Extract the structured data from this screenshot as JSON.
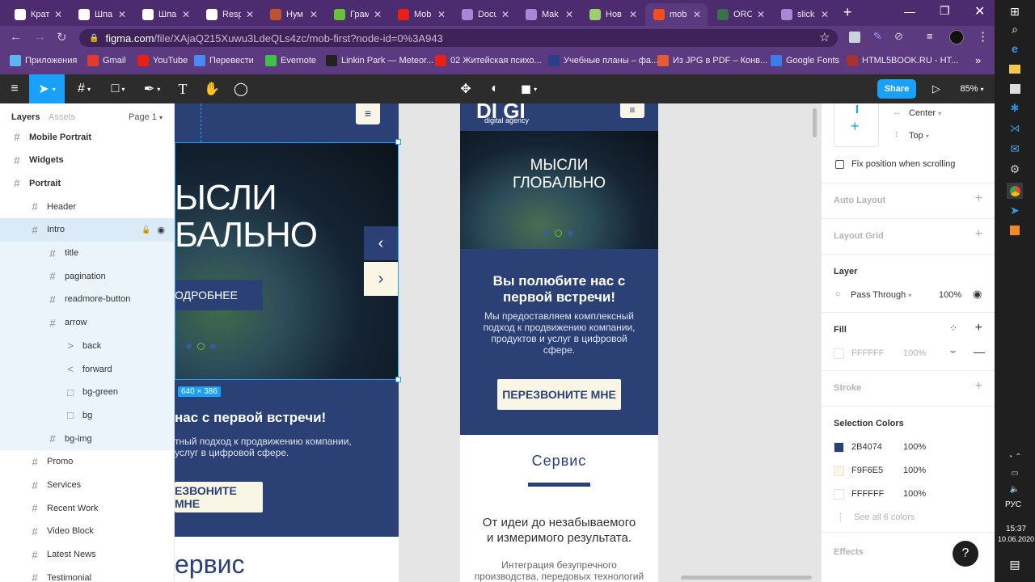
{
  "browser": {
    "tabs": [
      {
        "label": "Крат",
        "color": "#ffffff",
        "active": false
      },
      {
        "label": "Шпа",
        "color": "#ffffff",
        "active": false
      },
      {
        "label": "Шпа",
        "color": "#ffffff",
        "active": false
      },
      {
        "label": "Resp",
        "color": "#ffffff",
        "active": false
      },
      {
        "label": "Нум",
        "color": "#c0522e",
        "active": false
      },
      {
        "label": "Грам",
        "color": "#6cbf3a",
        "active": false
      },
      {
        "label": "Mob",
        "color": "#e62117",
        "active": false
      },
      {
        "label": "Docu",
        "color": "#a987d6",
        "active": false
      },
      {
        "label": "Mak",
        "color": "#a987d6",
        "active": false
      },
      {
        "label": "Нов",
        "color": "#9ccf6e",
        "active": false
      },
      {
        "label": "mob",
        "color": "#f24e1e",
        "active": true
      },
      {
        "label": "ORO",
        "color": "#3c6e4a",
        "active": false
      },
      {
        "label": "slick",
        "color": "#a987d6",
        "active": false
      }
    ],
    "new_tab": "+",
    "url_host": "figma.com",
    "url_path": "/file/XAjaQ215Xuwu3LdeQLs4zc/mob-first?node-id=0%3A943",
    "bookmarks": [
      {
        "label": "Приложения",
        "color": "#5ab5f0"
      },
      {
        "label": "Gmail",
        "color": "#e23a2e"
      },
      {
        "label": "YouTube",
        "color": "#e62117"
      },
      {
        "label": "Перевести",
        "color": "#4a8af4"
      },
      {
        "label": "Evernote",
        "color": "#3ec146"
      },
      {
        "label": "Linkin Park — Meteor...",
        "color": "#222222"
      },
      {
        "label": "02 Житейская психо...",
        "color": "#e62117"
      },
      {
        "label": "Учебные планы – фа...",
        "color": "#2b3e8c"
      },
      {
        "label": "Из JPG в PDF – Конв...",
        "color": "#e25c3a"
      },
      {
        "label": "Google Fonts",
        "color": "#3b7bea"
      },
      {
        "label": "HTML5BOOK.RU - НТ...",
        "color": "#a83232"
      }
    ],
    "bookmarks_more": "»"
  },
  "figma": {
    "share_label": "Share",
    "zoom": "85%",
    "left_tabs": {
      "layers": "Layers",
      "assets": "Assets",
      "page": "Page 1"
    },
    "layers": [
      {
        "label": "Mobile Portrait",
        "indent": 0,
        "bold": true,
        "icon": "#"
      },
      {
        "label": "Widgets",
        "indent": 0,
        "bold": true,
        "icon": "#"
      },
      {
        "label": "Portrait",
        "indent": 0,
        "bold": true,
        "icon": "#"
      },
      {
        "label": "Header",
        "indent": 1,
        "icon": "#"
      },
      {
        "label": "Intro",
        "indent": 1,
        "icon": "#",
        "selected": true
      },
      {
        "label": "title",
        "indent": 2,
        "icon": "#"
      },
      {
        "label": "pagination",
        "indent": 2,
        "icon": "#"
      },
      {
        "label": "readmore-button",
        "indent": 2,
        "icon": "#"
      },
      {
        "label": "arrow",
        "indent": 2,
        "icon": "#"
      },
      {
        "label": "back",
        "indent": 3,
        "icon": ">"
      },
      {
        "label": "forward",
        "indent": 3,
        "icon": "<"
      },
      {
        "label": "bg-green",
        "indent": 3,
        "icon": "□"
      },
      {
        "label": "bg",
        "indent": 3,
        "icon": "□"
      },
      {
        "label": "bg-img",
        "indent": 2,
        "icon": "#"
      },
      {
        "label": "Promo",
        "indent": 1,
        "icon": "#"
      },
      {
        "label": "Services",
        "indent": 1,
        "icon": "#"
      },
      {
        "label": "Recent Work",
        "indent": 1,
        "icon": "#"
      },
      {
        "label": "Video Block",
        "indent": 1,
        "icon": "#"
      },
      {
        "label": "Latest News",
        "indent": 1,
        "icon": "#"
      },
      {
        "label": "Testimonial",
        "indent": 1,
        "icon": "#"
      }
    ],
    "canvas": {
      "frame_a": {
        "hero_line1": "ЫСЛИ",
        "hero_line2": "БАЛЬНО",
        "readmore": "ОДРОБНЕЕ",
        "size_badge": "640 × 386",
        "promo_title": "нас с первой встречи!",
        "promo_text1": "тный подход к продвижению компании,",
        "promo_text2": "услуг в цифровой сфере.",
        "callback": "ЕЗВОНИТЕ МНЕ",
        "service": "ервис"
      },
      "frame_b": {
        "logo": "DI GI",
        "logo_sub": "digital agency",
        "hero1": "МЫСЛИ",
        "hero2": "ГЛОБАЛЬНО",
        "promo_title1": "Вы полюбите нас с",
        "promo_title2": "первой встречи!",
        "promo_text1": "Мы предоставляем комплексный",
        "promo_text2": "подход к продвижению компании,",
        "promo_text3": "продуктов и услуг в цифровой",
        "promo_text4": "сфере.",
        "callback": "ПЕРЕЗВОНИТЕ МНЕ",
        "service": "Сервис",
        "tagline1": "От идеи до незабываемого",
        "tagline2": "и измеримого результата.",
        "text1": "Интеграция безупречного",
        "text2": "производства, передовых технологий"
      }
    },
    "right": {
      "align_h": "Center",
      "align_v": "Top",
      "fix_position": "Fix position when scrolling",
      "auto_layout": "Auto Layout",
      "layout_grid": "Layout Grid",
      "layer": "Layer",
      "blend": "Pass Through",
      "layer_opacity": "100%",
      "fill": "Fill",
      "fill_hex": "FFFFFF",
      "fill_opacity": "100%",
      "stroke": "Stroke",
      "selection_colors": "Selection Colors",
      "colors": [
        {
          "hex": "2B4074",
          "swatch": "#2B4074",
          "opacity": "100%"
        },
        {
          "hex": "F9F6E5",
          "swatch": "#F9F6E5",
          "opacity": "100%"
        },
        {
          "hex": "FFFFFF",
          "swatch": "#FFFFFF",
          "opacity": "100%"
        }
      ],
      "see_all": "See all 6 colors",
      "effects": "Effects",
      "help": "?"
    }
  },
  "taskbar": {
    "lang": "РУС",
    "time": "15:37",
    "date": "10.06.2020"
  },
  "colors": {
    "navy": "#2B4074",
    "cream": "#F9F6E5",
    "figma_blue": "#18A0FB",
    "chrome_purple": "#5B3A80"
  }
}
